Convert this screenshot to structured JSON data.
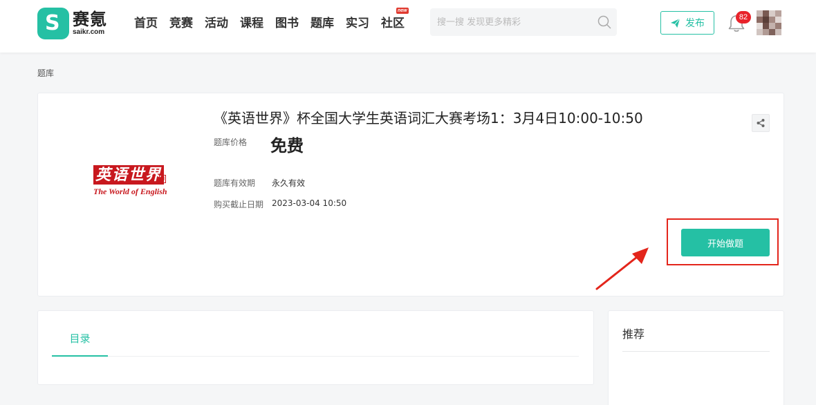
{
  "header": {
    "logo": {
      "cn": "赛氪",
      "en": "saikr.com"
    },
    "nav": [
      {
        "label": "首页"
      },
      {
        "label": "竞赛"
      },
      {
        "label": "活动"
      },
      {
        "label": "课程"
      },
      {
        "label": "图书"
      },
      {
        "label": "题库"
      },
      {
        "label": "实习"
      },
      {
        "label": "社区",
        "badge": "new"
      }
    ],
    "search": {
      "placeholder": "搜一搜 发现更多精彩",
      "value": ""
    },
    "publish_label": "发布",
    "notification_count": "82",
    "accent_color": "#25c0a4"
  },
  "breadcrumb": "题库",
  "question_bank": {
    "cover": {
      "cn": "英语世界",
      "en": "The World of English",
      "seal": "印"
    },
    "title": "《英语世界》杯全国大学生英语词汇大赛考场1：3月4日10:00-10:50",
    "price_label": "题库价格",
    "price_value": "免费",
    "validity_label": "题库有效期",
    "validity_value": "永久有效",
    "deadline_label": "购买截止日期",
    "deadline_value": "2023-03-04 10:50",
    "start_button": "开始做题",
    "highlight_color": "#e3251b"
  },
  "toc": {
    "tab_label": "目录"
  },
  "recommend": {
    "title": "推荐"
  }
}
